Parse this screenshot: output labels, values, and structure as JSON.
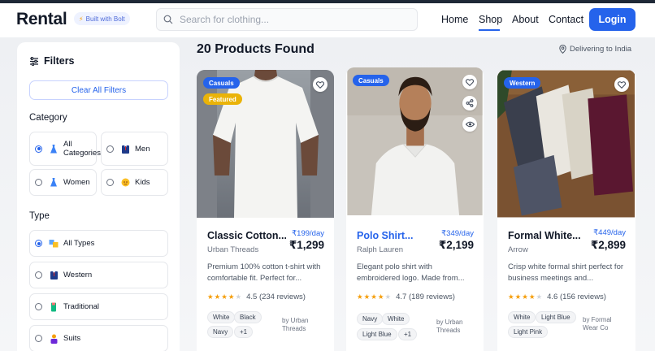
{
  "header": {
    "logo": "Rental",
    "badge": "Built with Bolt",
    "search_placeholder": "Search for clothing...",
    "nav": [
      "Home",
      "Shop",
      "About",
      "Contact"
    ],
    "active_nav": "Shop",
    "login": "Login"
  },
  "sidebar": {
    "title": "Filters",
    "clear": "Clear All Filters",
    "category_label": "Category",
    "categories": [
      {
        "label": "All Categories",
        "selected": true,
        "icon": "dress-icon"
      },
      {
        "label": "Men",
        "selected": false,
        "icon": "suit-icon"
      },
      {
        "label": "Women",
        "selected": false,
        "icon": "dress-icon"
      },
      {
        "label": "Kids",
        "selected": false,
        "icon": "child-face-icon"
      }
    ],
    "type_label": "Type",
    "types": [
      {
        "label": "All Types",
        "selected": true,
        "icon": "shirts-icon"
      },
      {
        "label": "Western",
        "selected": false,
        "icon": "suit-icon"
      },
      {
        "label": "Traditional",
        "selected": false,
        "icon": "kurta-icon"
      },
      {
        "label": "Suits",
        "selected": false,
        "icon": "businessman-icon"
      }
    ]
  },
  "results": {
    "title": "20 Products Found",
    "delivering": "Delivering to India"
  },
  "products": [
    {
      "badges": [
        "Casuals",
        "Featured"
      ],
      "name": "Classic Cotton...",
      "per_day": "₹199/day",
      "brand": "Urban Threads",
      "price": "₹1,299",
      "desc": "Premium 100% cotton t-shirt with comfortable fit. Perfect for...",
      "rating_value": 4.5,
      "rating": "4.5 (234 reviews)",
      "colors": [
        "White",
        "Black",
        "Navy",
        "+1"
      ],
      "byline": "by Urban Threads"
    },
    {
      "badges": [
        "Casuals"
      ],
      "name": "Polo Shirt...",
      "per_day": "₹349/day",
      "brand": "Ralph Lauren",
      "price": "₹2,199",
      "desc": "Elegant polo shirt with embroidered logo. Made from...",
      "rating_value": 4.7,
      "rating": "4.7 (189 reviews)",
      "colors": [
        "Navy",
        "White",
        "Light Blue",
        "+1"
      ],
      "byline": "by Urban Threads"
    },
    {
      "badges": [
        "Western"
      ],
      "name": "Formal White...",
      "per_day": "₹449/day",
      "brand": "Arrow",
      "price": "₹2,899",
      "desc": "Crisp white formal shirt perfect for business meetings and...",
      "rating_value": 4.6,
      "rating": "4.6 (156 reviews)",
      "colors": [
        "White",
        "Light Blue",
        "Light Pink"
      ],
      "byline": "by Formal Wear Co"
    }
  ],
  "colors": {
    "accent": "#2563eb",
    "featured": "#eab308",
    "star": "#f59e0b"
  }
}
